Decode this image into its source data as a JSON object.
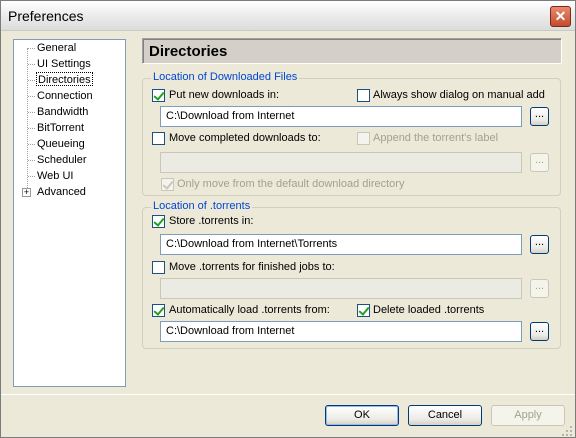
{
  "window": {
    "title": "Preferences"
  },
  "tree": {
    "items": [
      {
        "label": "General"
      },
      {
        "label": "UI Settings"
      },
      {
        "label": "Directories",
        "selected": true
      },
      {
        "label": "Connection"
      },
      {
        "label": "Bandwidth"
      },
      {
        "label": "BitTorrent"
      },
      {
        "label": "Queueing"
      },
      {
        "label": "Scheduler"
      },
      {
        "label": "Web UI"
      },
      {
        "label": "Advanced",
        "expandable": true,
        "expander": "+"
      }
    ]
  },
  "panel": {
    "title": "Directories"
  },
  "downloaded": {
    "legend": "Location of Downloaded Files",
    "put_new_label": "Put new downloads in:",
    "put_new_checked": true,
    "always_show_label": "Always show dialog on manual add",
    "always_show_checked": false,
    "download_path": "C:\\Download from Internet",
    "move_completed_label": "Move completed downloads to:",
    "move_completed_checked": false,
    "append_label_label": "Append the torrent's label",
    "append_label_checked": false,
    "move_completed_path": "",
    "only_move_label": "Only move from the default download directory",
    "only_move_checked": true
  },
  "torrents": {
    "legend": "Location of .torrents",
    "store_label": "Store .torrents in:",
    "store_checked": true,
    "store_path": "C:\\Download from Internet\\Torrents",
    "move_finished_label": "Move .torrents for finished jobs to:",
    "move_finished_checked": false,
    "move_finished_path": "",
    "auto_load_label": "Automatically load .torrents from:",
    "auto_load_checked": true,
    "delete_loaded_label": "Delete loaded .torrents",
    "delete_loaded_checked": true,
    "auto_load_path": "C:\\Download from Internet"
  },
  "browse_label": "...",
  "buttons": {
    "ok": "OK",
    "cancel": "Cancel",
    "apply": "Apply"
  },
  "colors": {
    "accent": "#0046d5",
    "close": "#c44a2c",
    "check": "#21a121"
  }
}
